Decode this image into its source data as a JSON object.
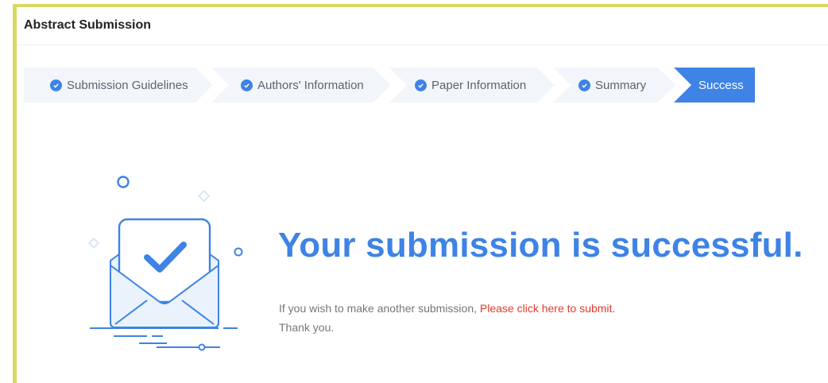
{
  "header": {
    "title": "Abstract Submission"
  },
  "steps": [
    {
      "label": "Submission Guidelines",
      "status": "done"
    },
    {
      "label": "Authors' Information",
      "status": "done"
    },
    {
      "label": "Paper Information",
      "status": "done"
    },
    {
      "label": "Summary",
      "status": "done"
    },
    {
      "label": "Success",
      "status": "current"
    }
  ],
  "message": {
    "headline": "Your submission is successful.",
    "prompt": "If you wish to make another submission, ",
    "link": "Please click here to submit",
    "period": ".",
    "thanks": "Thank you."
  },
  "colors": {
    "accent": "#3e83e5",
    "link": "#e23b2b",
    "frame": "#d8d862",
    "step_bg": "#f2f6fb"
  }
}
